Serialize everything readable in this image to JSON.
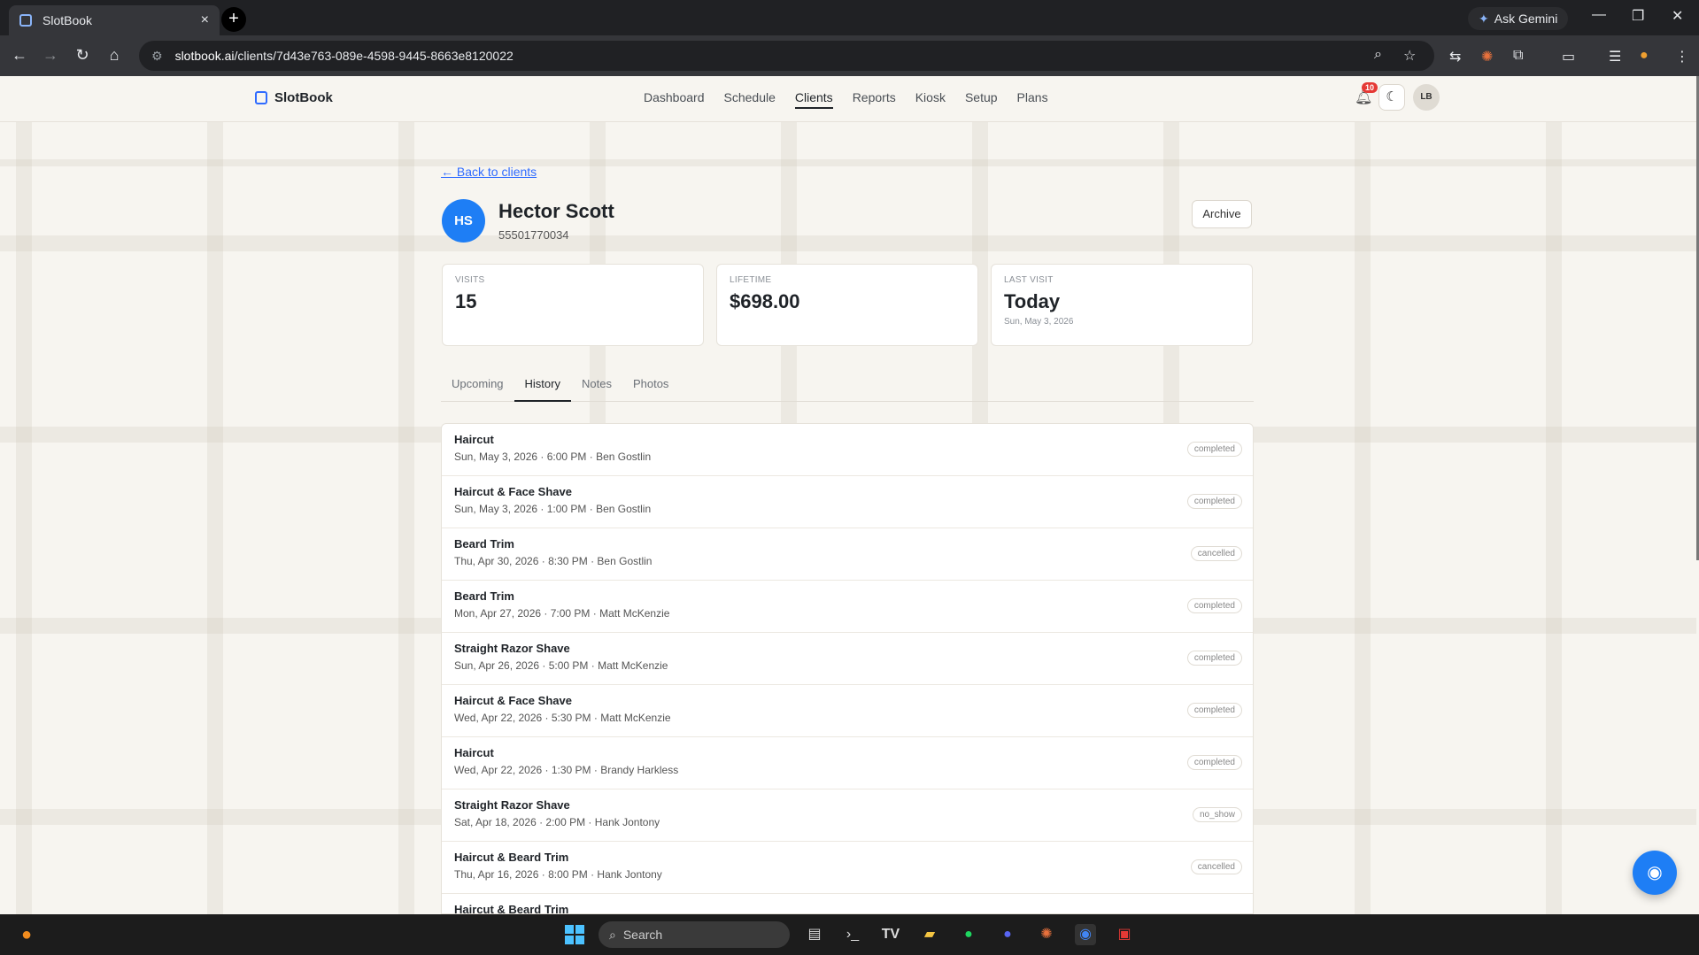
{
  "browser": {
    "tab_title": "SlotBook",
    "tab_close": "×",
    "new_tab": "+",
    "ask_gemini": "Ask Gemini",
    "url_host": "slotbook.ai",
    "url_path": "/clients/7d43e763-089e-4598-9445-8663e8120022"
  },
  "app": {
    "brand": "SlotBook",
    "nav": [
      "Dashboard",
      "Schedule",
      "Clients",
      "Reports",
      "Kiosk",
      "Setup",
      "Plans"
    ],
    "active_nav": "Clients",
    "notifications_count": "10",
    "user_initials": "LB"
  },
  "client": {
    "back_link": "← Back to clients",
    "initials": "HS",
    "name": "Hector Scott",
    "phone": "55501770034",
    "archive_label": "Archive"
  },
  "stats": [
    {
      "label": "VISITS",
      "value": "15",
      "sub": ""
    },
    {
      "label": "LIFETIME",
      "value": "$698.00",
      "sub": ""
    },
    {
      "label": "LAST VISIT",
      "value": "Today",
      "sub": "Sun, May 3, 2026"
    }
  ],
  "tabs": [
    "Upcoming",
    "History",
    "Notes",
    "Photos"
  ],
  "active_tab": "History",
  "history": [
    {
      "service": "Haircut",
      "meta": "Sun, May 3, 2026 · 6:00 PM · Ben Gostlin",
      "status": "completed"
    },
    {
      "service": "Haircut & Face Shave",
      "meta": "Sun, May 3, 2026 · 1:00 PM · Ben Gostlin",
      "status": "completed"
    },
    {
      "service": "Beard Trim",
      "meta": "Thu, Apr 30, 2026 · 8:30 PM · Ben Gostlin",
      "status": "cancelled"
    },
    {
      "service": "Beard Trim",
      "meta": "Mon, Apr 27, 2026 · 7:00 PM · Matt McKenzie",
      "status": "completed"
    },
    {
      "service": "Straight Razor Shave",
      "meta": "Sun, Apr 26, 2026 · 5:00 PM · Matt McKenzie",
      "status": "completed"
    },
    {
      "service": "Haircut & Face Shave",
      "meta": "Wed, Apr 22, 2026 · 5:30 PM · Matt McKenzie",
      "status": "completed"
    },
    {
      "service": "Haircut",
      "meta": "Wed, Apr 22, 2026 · 1:30 PM · Brandy Harkless",
      "status": "completed"
    },
    {
      "service": "Straight Razor Shave",
      "meta": "Sat, Apr 18, 2026 · 2:00 PM · Hank Jontony",
      "status": "no_show"
    },
    {
      "service": "Haircut & Beard Trim",
      "meta": "Thu, Apr 16, 2026 · 8:00 PM · Hank Jontony",
      "status": "cancelled"
    },
    {
      "service": "Haircut & Beard Trim",
      "meta": "",
      "status": ""
    }
  ],
  "taskbar": {
    "search_placeholder": "Search"
  },
  "colors": {
    "accent": "#1e7ef5",
    "link": "#2f6bff",
    "background": "#f7f5f0"
  }
}
